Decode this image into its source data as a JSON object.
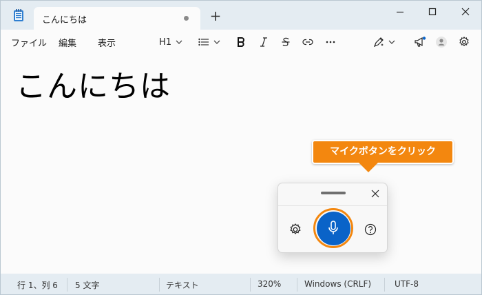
{
  "tab": {
    "title": "こんにちは"
  },
  "menu": {
    "file": "ファイル",
    "edit": "編集",
    "view": "表示"
  },
  "toolbar": {
    "heading": "H1"
  },
  "editor": {
    "content": "こんにちは"
  },
  "callout": {
    "text": "マイクボタンをクリック"
  },
  "status": {
    "position": "行 1、列 6",
    "chars": "5 文字",
    "format": "テキスト",
    "zoom": "320%",
    "line_ending": "Windows (CRLF)",
    "encoding": "UTF-8"
  },
  "colors": {
    "accent_orange": "#f3870f",
    "mic_blue": "#0a63c8",
    "chrome": "#e4ecf2"
  },
  "icons": [
    "notepad-icon",
    "close-icon",
    "plus-icon",
    "minimize-icon",
    "maximize-icon",
    "list-icon",
    "bold-icon",
    "italic-icon",
    "strikethrough-icon",
    "link-icon",
    "more-icon",
    "copilot-pen-icon",
    "megaphone-icon",
    "avatar-icon",
    "gear-icon",
    "microphone-icon",
    "help-icon"
  ]
}
